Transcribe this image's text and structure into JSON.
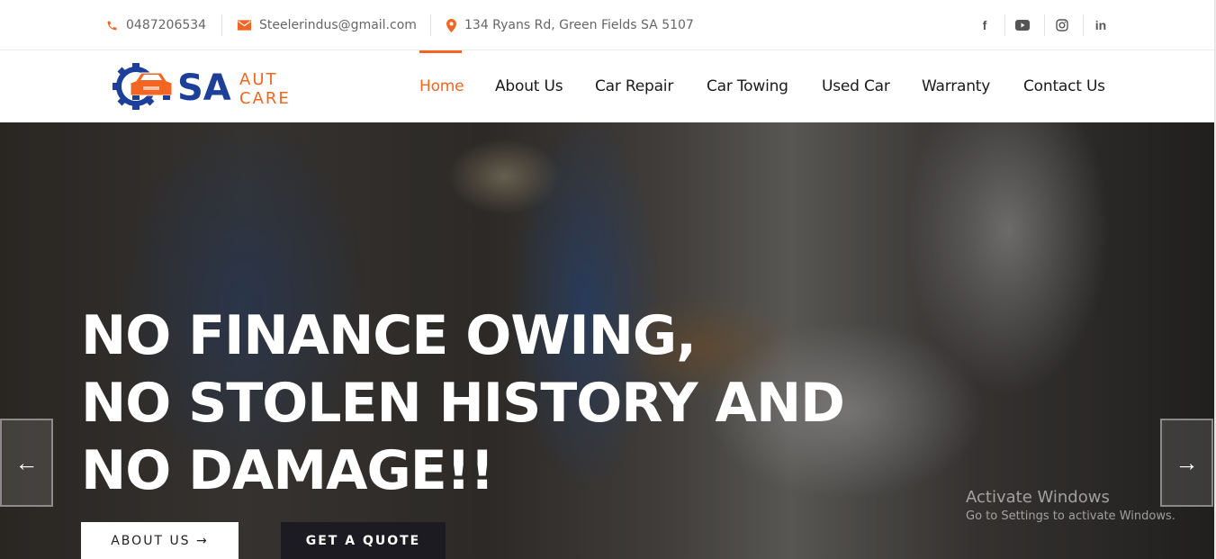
{
  "topbar": {
    "phone": {
      "icon": "phone-icon",
      "text": "0487206534"
    },
    "email": {
      "icon": "mail-icon",
      "text": "Steelerindus@gmail.com"
    },
    "address": {
      "icon": "map-pin-icon",
      "text": "134 Ryans Rd, Green Fields SA 5107"
    },
    "social": [
      {
        "name": "facebook",
        "glyph": "f"
      },
      {
        "name": "youtube",
        "glyph": "▶"
      },
      {
        "name": "instagram",
        "glyph": "◎"
      },
      {
        "name": "linkedin",
        "glyph": "in"
      }
    ]
  },
  "logo": {
    "main": "SA",
    "line1": "AUTO",
    "line2": "CARE",
    "primary_color": "#1d3f9a",
    "accent_color": "#f26522"
  },
  "nav": {
    "items": [
      {
        "label": "Home",
        "active": true
      },
      {
        "label": "About Us",
        "active": false
      },
      {
        "label": "Car Repair",
        "active": false
      },
      {
        "label": "Car Towing",
        "active": false
      },
      {
        "label": "Used Car",
        "active": false
      },
      {
        "label": "Warranty",
        "active": false
      },
      {
        "label": "Contact Us",
        "active": false
      }
    ],
    "accent_color": "#f26522"
  },
  "hero": {
    "title_lines": [
      "NO FINANCE OWING,",
      "NO STOLEN HISTORY AND",
      "NO DAMAGE!!"
    ],
    "prev_arrow": "←",
    "next_arrow": "→",
    "buttons": {
      "about": "ABOUT US →",
      "quote": "GET A QUOTE"
    }
  },
  "watermark": {
    "title": "Activate Windows",
    "subtitle": "Go to Settings to activate Windows."
  }
}
